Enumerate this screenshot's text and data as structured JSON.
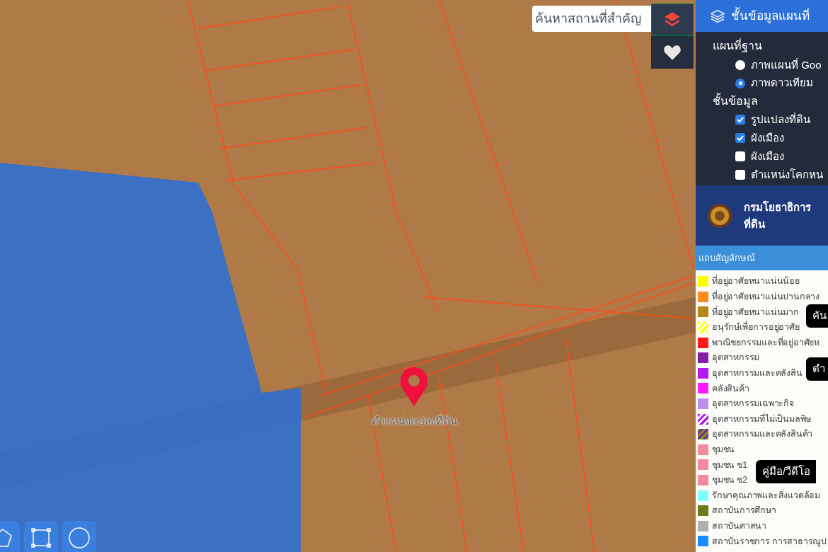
{
  "map": {
    "search": {
      "placeholder": "ค้นหาสถานที่สำคัญ"
    },
    "side_buttons": [
      {
        "kind": "layers",
        "selected": true
      },
      {
        "kind": "favorites",
        "selected": false
      }
    ],
    "marker": {
      "label": "ตำแหน่งแปลงที่ดิน"
    },
    "draw_tools": [
      {
        "kind": "polygon"
      },
      {
        "kind": "rectangle"
      },
      {
        "kind": "circle"
      }
    ]
  },
  "panel": {
    "title": "ชั้นข้อมูลแผนที่",
    "base_map": {
      "heading": "แผนที่ฐาน",
      "options": [
        {
          "label": "ภาพแผนที่ Goo",
          "selected": false
        },
        {
          "label": "ภาพดาวเทียม",
          "selected": true
        }
      ]
    },
    "layers": {
      "heading": "ชั้นข้อมูล",
      "items": [
        {
          "label": "รูปแปลงที่ดิน",
          "checked": true
        },
        {
          "label": "ผังเมือง",
          "checked": true
        },
        {
          "label": "ผังเมือง",
          "checked": false
        },
        {
          "label": "ตำแหน่งโคกหน",
          "checked": false
        }
      ]
    }
  },
  "agency": {
    "lines": [
      "กรมโยธาธิการ",
      "ที่ดิน"
    ]
  },
  "legend": {
    "title": "แถบสัญลักษณ์",
    "items": [
      {
        "kind": "solid",
        "color": "#ffff00",
        "label": "ที่อยู่อาศัยหนาแน่นน้อย"
      },
      {
        "kind": "solid",
        "color": "#ff8a1e",
        "label": "ที่อยู่อาศัยหนาแน่นปานกลาง"
      },
      {
        "kind": "solid",
        "color": "#b8861a",
        "label": "ที่อยู่อาศัยหนาแน่นมาก"
      },
      {
        "kind": "striped",
        "color": "#ffff00",
        "label": "อนุรักษ์เพื่อการอยู่อาศัย"
      },
      {
        "kind": "solid",
        "color": "#ff1a1a",
        "label": "พาณิชยกรรมและที่อยู่อาศัยห"
      },
      {
        "kind": "solid",
        "color": "#8a1aa8",
        "label": "อุตสาหกรรม"
      },
      {
        "kind": "solid",
        "color": "#b41ae8",
        "label": "อุตสาหกรรมและคลังสิน"
      },
      {
        "kind": "solid",
        "color": "#ff1aff",
        "label": "คลังสินค้า"
      },
      {
        "kind": "solid",
        "color": "#c08cf0",
        "label": "อุตสาหกรรมเฉพาะกิจ"
      },
      {
        "kind": "striped",
        "color": "#b41ae8",
        "label": "อุตสาหกรรมที่ไม่เป็นมลพิษ"
      },
      {
        "kind": "twotone",
        "color": "#6aa01a",
        "label": "อุตสาหกรรมและคลังสินค้า"
      },
      {
        "kind": "solid",
        "color": "#f28b9a",
        "label": "ชุมชน"
      },
      {
        "kind": "solid",
        "color": "#f28b99",
        "label": "ชุมชน ช1"
      },
      {
        "kind": "solid",
        "color": "#f28b98",
        "label": "ชุมชน ช2"
      },
      {
        "kind": "solid",
        "color": "#80ffff",
        "label": "รักษาคุณภาพและสิ่งแวดล้อม"
      },
      {
        "kind": "solid",
        "color": "#6b7a1a",
        "label": "สถาบันการศึกษา"
      },
      {
        "kind": "solid",
        "color": "#b0b0b0",
        "label": "สถาบันศาสนา"
      },
      {
        "kind": "solid",
        "color": "#1a8cff",
        "label": "สถาบันราชการ การสาธารณูป"
      }
    ]
  },
  "floating_buttons": [
    {
      "label": "คัน"
    },
    {
      "label": "ตำ"
    },
    {
      "label": "คู่มือ/วีดีโอ"
    }
  ]
}
